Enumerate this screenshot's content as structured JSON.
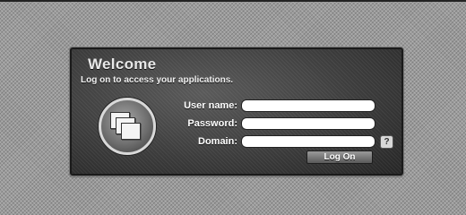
{
  "login": {
    "title": "Welcome",
    "subtitle": "Log on to access your applications.",
    "fields": {
      "username": {
        "label": "User name:",
        "value": ""
      },
      "password": {
        "label": "Password:",
        "value": ""
      },
      "domain": {
        "label": "Domain:",
        "value": ""
      }
    },
    "help_icon": {
      "name": "help-icon",
      "glyph": "?"
    },
    "logon_button": "Log On",
    "logo_icon": "application-windows-icon"
  }
}
